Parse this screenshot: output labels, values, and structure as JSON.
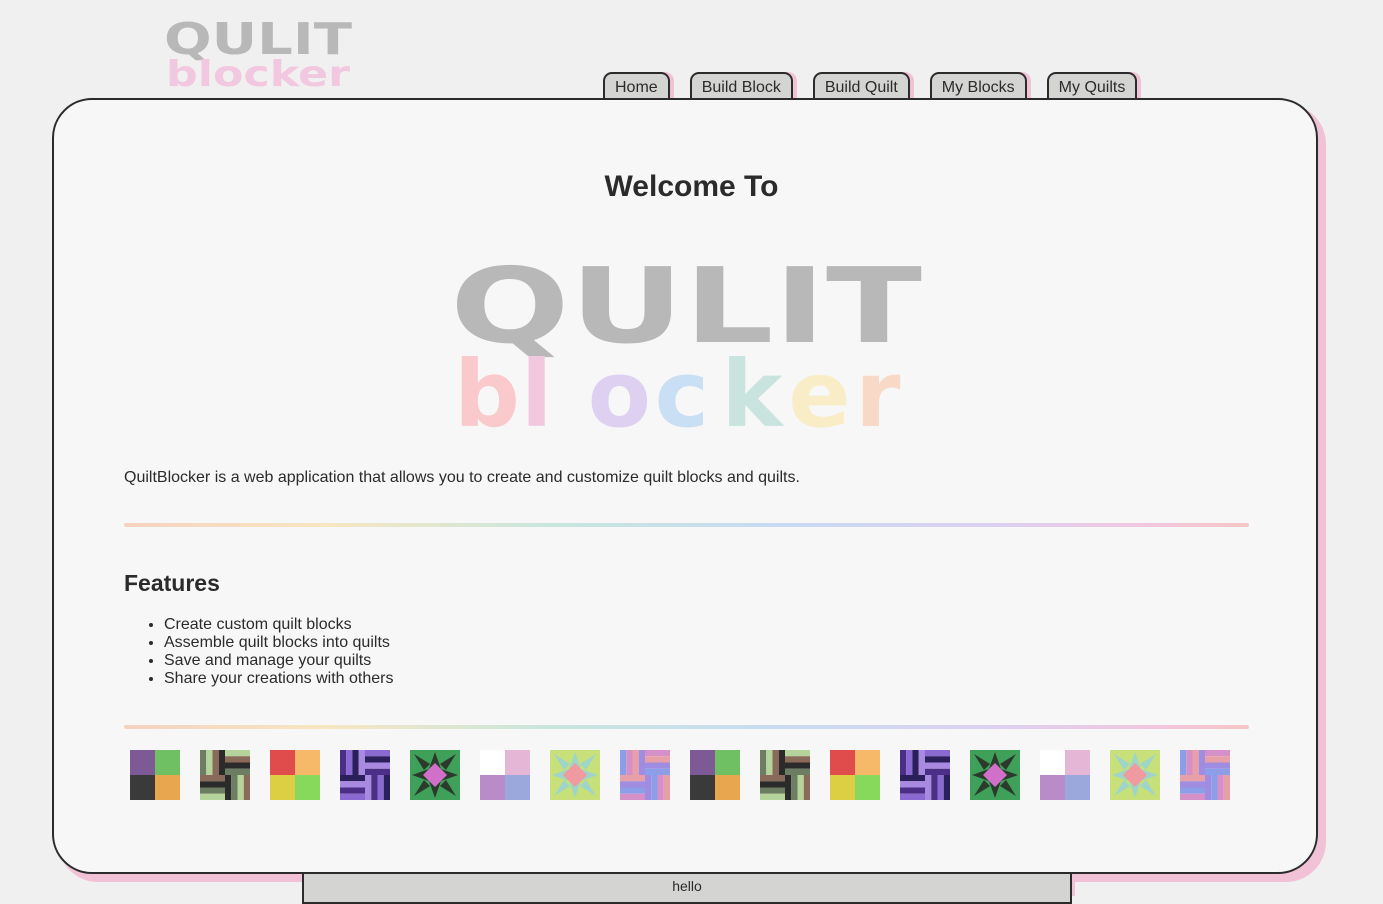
{
  "brand": {
    "logo_top": "QULIT",
    "logo_bottom": "blocker",
    "logo_top_color": "#b8b8b8",
    "logo_bottom_colors": [
      "#f9c9cc",
      "#f2c8e0",
      "#ddd0f0",
      "#c9dff4",
      "#c9e4df",
      "#f9edc8",
      "#f8d8c6"
    ]
  },
  "nav": {
    "tabs": [
      {
        "label": "Home"
      },
      {
        "label": "Build Block"
      },
      {
        "label": "Build Quilt"
      },
      {
        "label": "My Blocks"
      },
      {
        "label": "My Quilts"
      }
    ]
  },
  "main": {
    "welcome": "Welcome To",
    "intro": "QuiltBlocker is a web application that allows you to create and customize quilt blocks and quilts.",
    "features_title": "Features",
    "features": [
      "Create custom quilt blocks",
      "Assemble quilt blocks into quilts",
      "Save and manage your quilts",
      "Share your creations with others"
    ],
    "divider_colors": [
      "#f5d2c0",
      "#f7e6c2",
      "#c8e6dd",
      "#c8dbf2",
      "#ddd0f0",
      "#f2c6dc"
    ]
  },
  "quilt_blocks": [
    {
      "pattern": "four-patch",
      "colors": [
        "#7d5a96",
        "#6fbf63",
        "#3a3a3a",
        "#e8a64e"
      ]
    },
    {
      "pattern": "rail-pinwheel",
      "colors": [
        "#6d7d62",
        "#b5d49b",
        "#8a6a58",
        "#2b2b2b"
      ]
    },
    {
      "pattern": "four-patch",
      "colors": [
        "#e04b4b",
        "#f5b969",
        "#dccf43",
        "#86d95b"
      ]
    },
    {
      "pattern": "rail-pinwheel",
      "colors": [
        "#4b2f86",
        "#8a6ad0",
        "#2b1f5c",
        "#a88be0"
      ]
    },
    {
      "pattern": "star",
      "colors": [
        "#3fa05a",
        "#2b3a2b",
        "#d070c8"
      ]
    },
    {
      "pattern": "four-patch",
      "colors": [
        "#ffffff",
        "#e5b6d6",
        "#b98cc9",
        "#9aa8dc"
      ]
    },
    {
      "pattern": "star",
      "colors": [
        "#c8e07a",
        "#9fd4c9",
        "#f09aa0"
      ]
    },
    {
      "pattern": "rail-pinwheel",
      "colors": [
        "#8c9ee8",
        "#d690c8",
        "#e8a0a8",
        "#a08ce0"
      ]
    },
    {
      "pattern": "four-patch",
      "colors": [
        "#7d5a96",
        "#6fbf63",
        "#3a3a3a",
        "#e8a64e"
      ]
    },
    {
      "pattern": "rail-pinwheel",
      "colors": [
        "#6d7d62",
        "#b5d49b",
        "#8a6a58",
        "#2b2b2b"
      ]
    },
    {
      "pattern": "four-patch",
      "colors": [
        "#e04b4b",
        "#f5b969",
        "#dccf43",
        "#86d95b"
      ]
    },
    {
      "pattern": "rail-pinwheel",
      "colors": [
        "#4b2f86",
        "#8a6ad0",
        "#2b1f5c",
        "#a88be0"
      ]
    },
    {
      "pattern": "star",
      "colors": [
        "#3fa05a",
        "#2b3a2b",
        "#d070c8"
      ]
    },
    {
      "pattern": "four-patch",
      "colors": [
        "#ffffff",
        "#e5b6d6",
        "#b98cc9",
        "#9aa8dc"
      ]
    },
    {
      "pattern": "star",
      "colors": [
        "#c8e07a",
        "#9fd4c9",
        "#f09aa0"
      ]
    },
    {
      "pattern": "rail-pinwheel",
      "colors": [
        "#8c9ee8",
        "#d690c8",
        "#e8a0a8",
        "#a08ce0"
      ]
    }
  ],
  "footer": {
    "text": "hello"
  }
}
